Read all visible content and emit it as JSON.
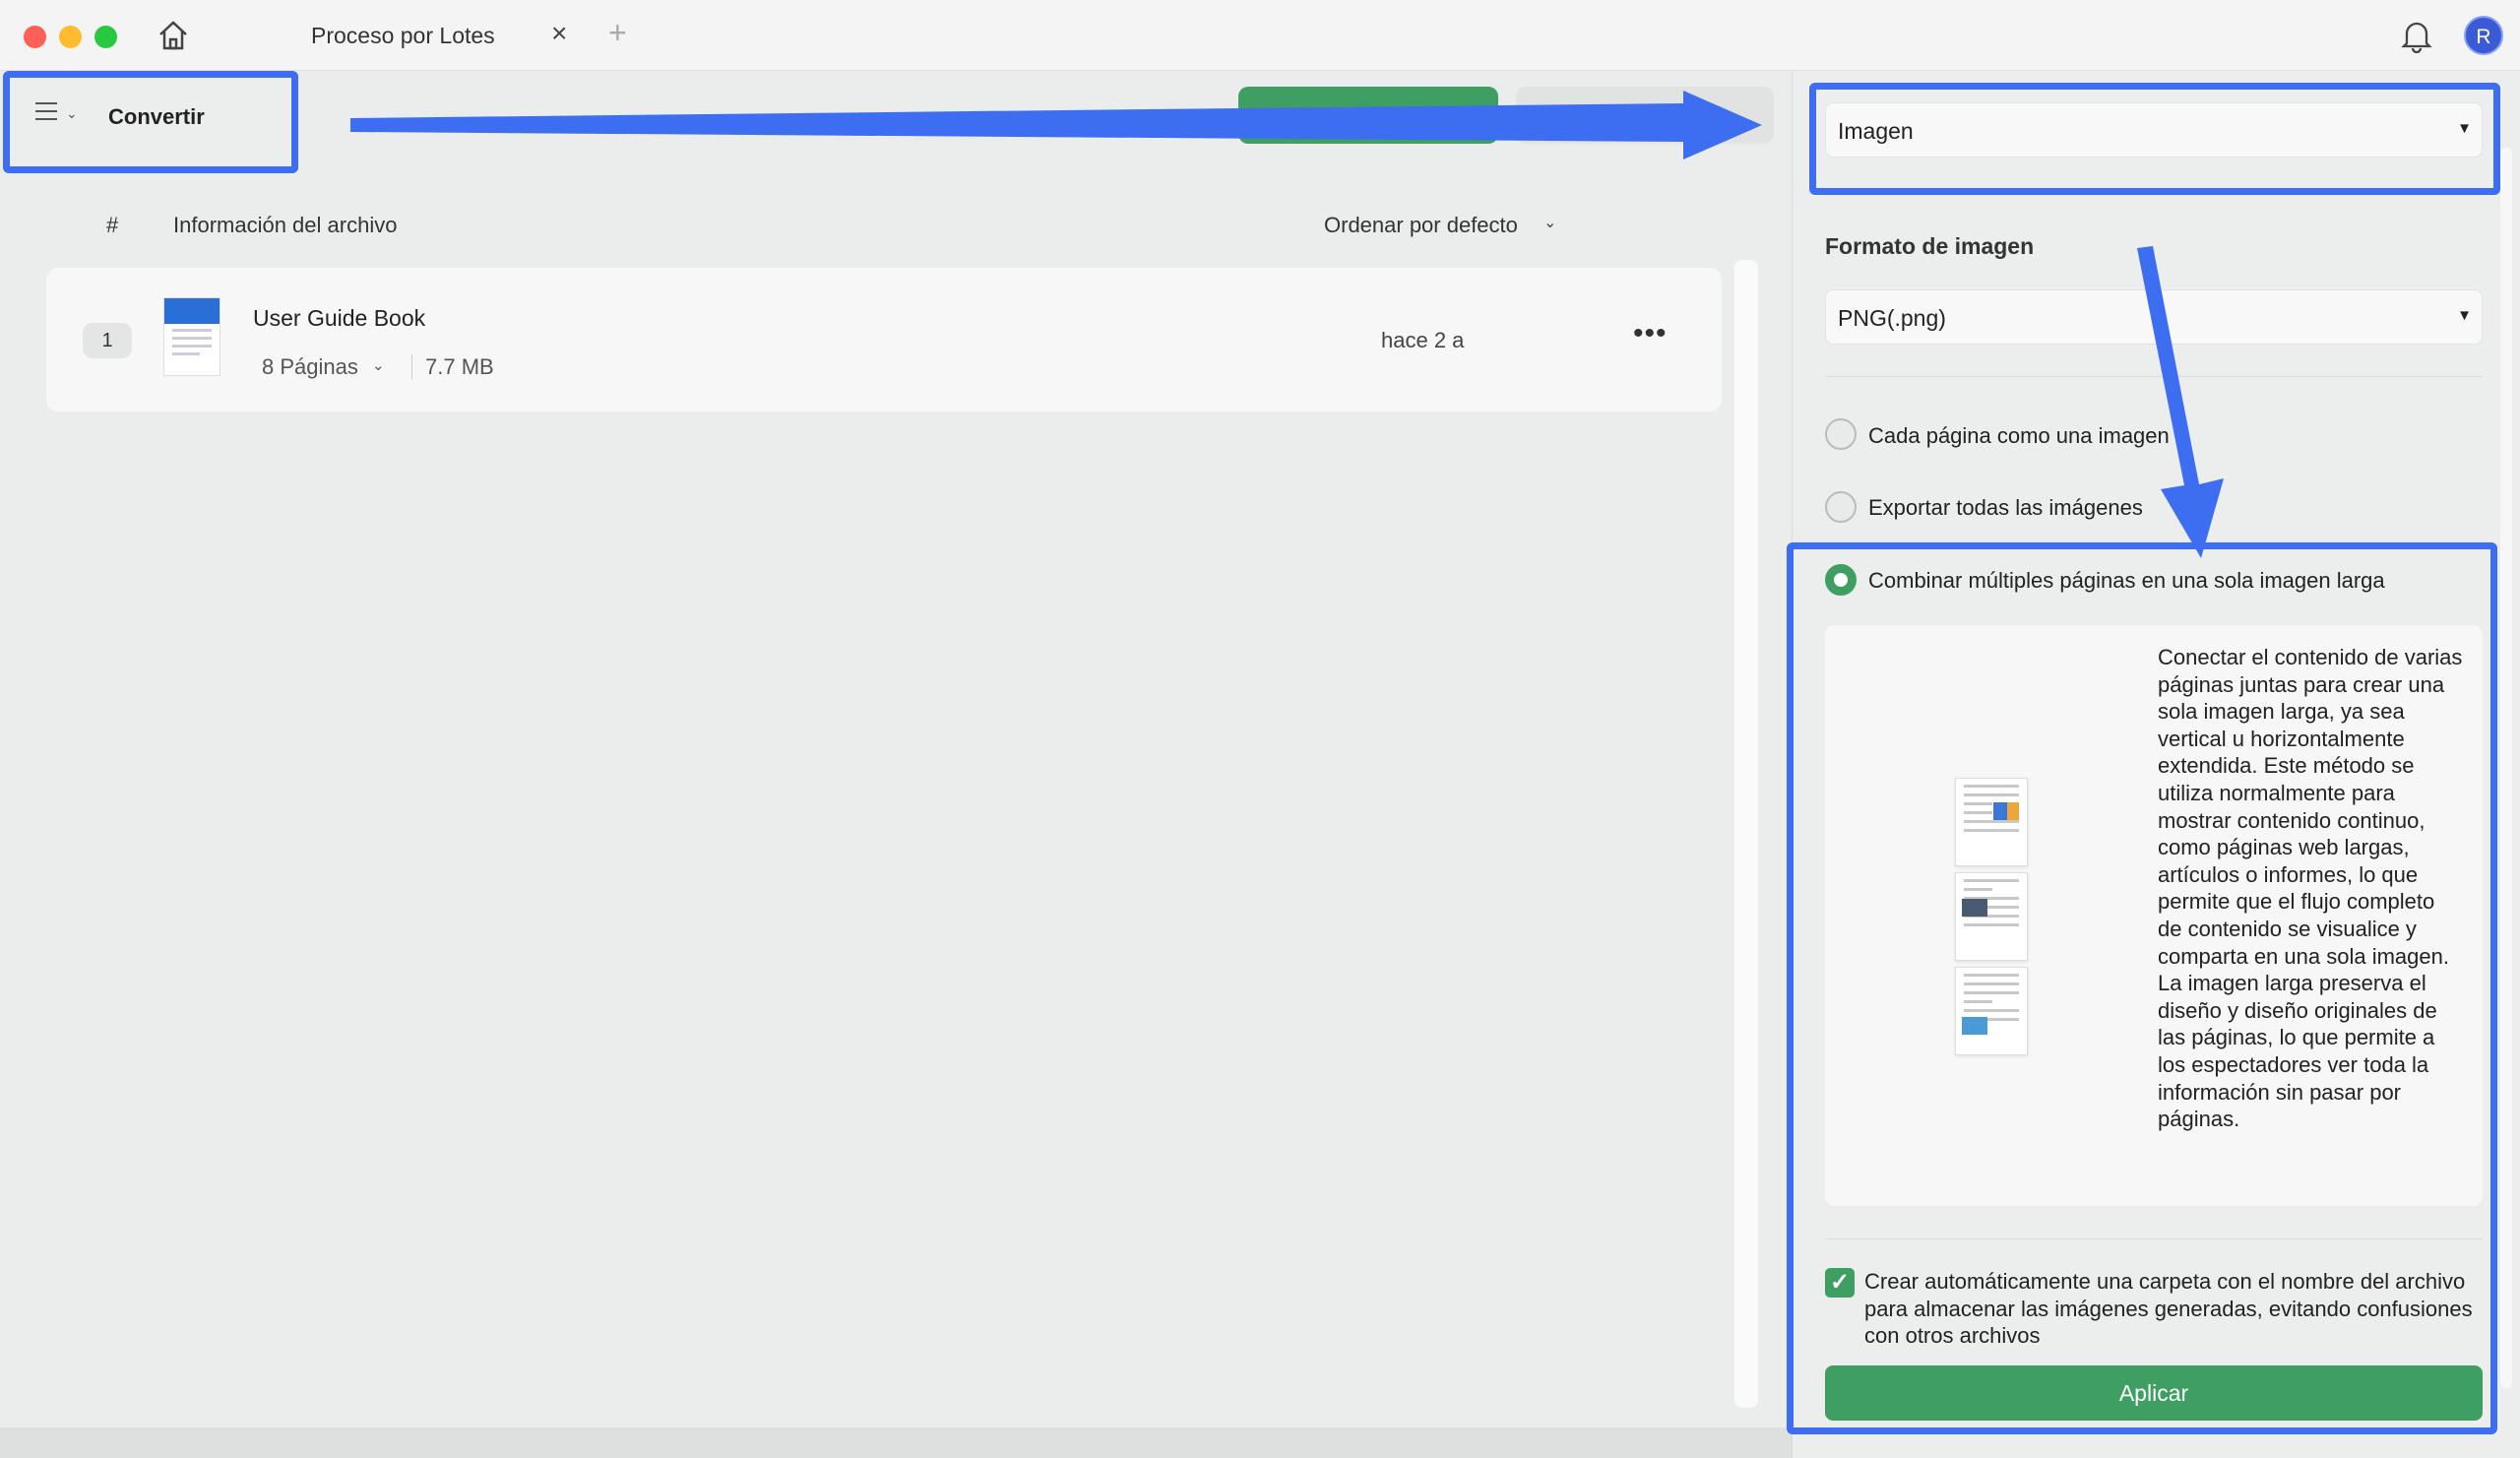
{
  "window": {
    "tab_title": "Proceso por Lotes",
    "close_glyph": "×",
    "add_glyph": "+"
  },
  "user": {
    "avatar_initial": "R"
  },
  "toolbar": {
    "mode_label": "Convertir"
  },
  "list": {
    "col_index": "#",
    "col_info": "Información del archivo",
    "sort_label": "Ordenar por defecto",
    "files": [
      {
        "index": "1",
        "name": "User Guide Book",
        "pages": "8 Páginas",
        "size": "7.7 MB",
        "time": "hace 2 a",
        "more": "•••"
      }
    ]
  },
  "panel": {
    "output_type": "Imagen",
    "format_label": "Formato de imagen",
    "format_value": "PNG(.png)",
    "options": [
      {
        "label": "Cada página como una imagen",
        "selected": false
      },
      {
        "label": "Exportar todas las imágenes",
        "selected": false
      },
      {
        "label": "Combinar múltiples páginas en una sola imagen larga",
        "selected": true
      }
    ],
    "description": "Conectar el contenido de varias páginas juntas para crear una sola imagen larga, ya sea vertical u horizontalmente extendida. Este método se utiliza normalmente para mostrar contenido continuo, como páginas web largas, artículos o informes, lo que permite que el flujo completo de contenido se visualice y comparta en una sola imagen. La imagen larga preserva el diseño y diseño originales de las páginas, lo que permite a los espectadores ver toda la información sin pasar por páginas.",
    "auto_folder_label": "Crear automáticamente una carpeta con el nombre del archivo para almacenar las imágenes generadas, evitando confusiones con otros archivos",
    "auto_folder_checked": true,
    "apply_label": "Aplicar"
  },
  "colors": {
    "accent_green": "#3f9e62",
    "highlight_blue": "#3d6ef1"
  }
}
